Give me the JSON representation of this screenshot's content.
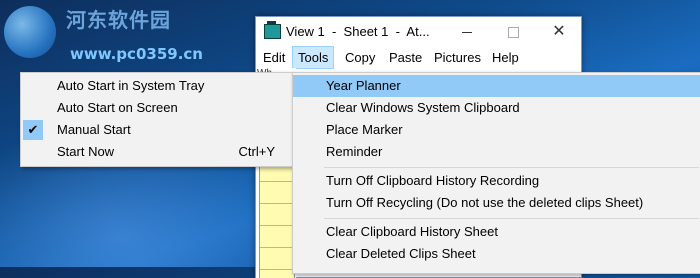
{
  "watermark": {
    "site_name": "河东软件园",
    "url": "www.pc0359.cn"
  },
  "window": {
    "title": "View 1  -  Sheet 1  -  At...",
    "minimize_icon": "minimize-icon",
    "maximize_icon": "maximize-icon",
    "close_glyph": "✕",
    "grid_header": "Wh"
  },
  "menubar": {
    "edit": "Edit",
    "tools": "Tools",
    "copy": "Copy",
    "paste": "Paste",
    "pictures": "Pictures",
    "help": "Help"
  },
  "left_menu": {
    "items": [
      {
        "label": "Auto Start in System Tray"
      },
      {
        "label": "Auto Start on Screen"
      },
      {
        "label": "Manual Start",
        "checked": true,
        "check_glyph": "✔"
      },
      {
        "label": "Start Now",
        "shortcut": "Ctrl+Y"
      }
    ]
  },
  "tools_menu": {
    "items": [
      {
        "label": "Year Planner",
        "highlighted": true
      },
      {
        "label": "Clear Windows System Clipboard"
      },
      {
        "label": "Place Marker"
      },
      {
        "label": "Reminder"
      },
      {
        "label": "Turn Off Clipboard History Recording"
      },
      {
        "label": "Turn Off Recycling (Do not use the deleted clips Sheet)"
      },
      {
        "label": "Clear Clipboard History Sheet"
      },
      {
        "label": "Clear Deleted Clips Sheet"
      }
    ]
  },
  "colors": {
    "menu_highlight": "#91c9f7",
    "menubar_active": "#cce8ff",
    "menu_background": "#f2f2f2"
  }
}
